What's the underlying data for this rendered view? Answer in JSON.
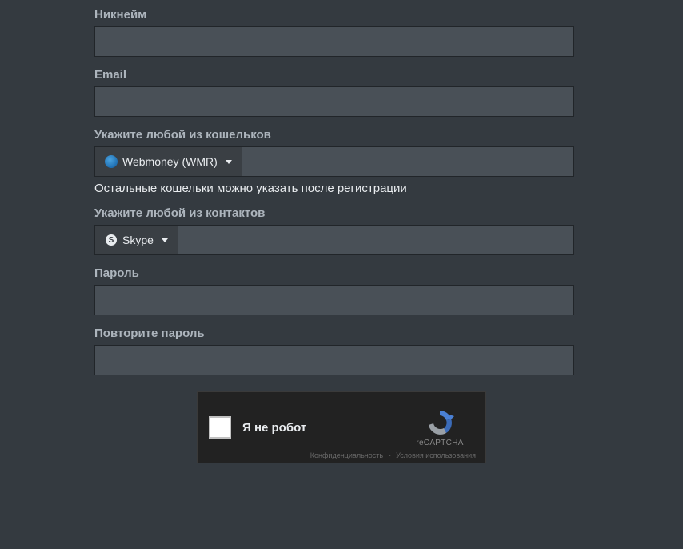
{
  "fields": {
    "nickname": {
      "label": "Никнейм",
      "value": ""
    },
    "email": {
      "label": "Email",
      "value": ""
    },
    "wallet": {
      "label": "Укажите любой из кошельков",
      "dropdown": "Webmoney (WMR)",
      "value": "",
      "hint": "Остальные кошельки можно указать после регистрации"
    },
    "contact": {
      "label": "Укажите любой из контактов",
      "dropdown": "Skype",
      "value": ""
    },
    "password": {
      "label": "Пароль",
      "value": ""
    },
    "password2": {
      "label": "Повторите пароль",
      "value": ""
    }
  },
  "captcha": {
    "label": "Я не робот",
    "brand": "reCAPTCHA",
    "privacy": "Конфиденциальность",
    "terms": "Условия использования",
    "sep": " - "
  }
}
